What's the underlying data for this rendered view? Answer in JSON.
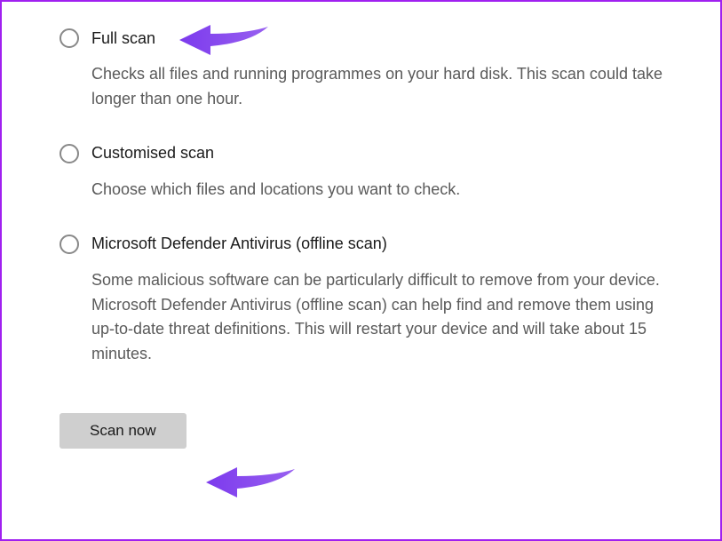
{
  "options": [
    {
      "label": "Full scan",
      "description": "Checks all files and running programmes on your hard disk. This scan could take longer than one hour."
    },
    {
      "label": "Customised scan",
      "description": "Choose which files and locations you want to check."
    },
    {
      "label": "Microsoft Defender Antivirus (offline scan)",
      "description": "Some malicious software can be particularly difficult to remove from your device. Microsoft Defender Antivirus (offline scan) can help find and remove them using up-to-date threat definitions. This will restart your device and will take about 15 minutes."
    }
  ],
  "button": {
    "label": "Scan now"
  },
  "annotations": {
    "arrow_color": "#7c3aed"
  }
}
